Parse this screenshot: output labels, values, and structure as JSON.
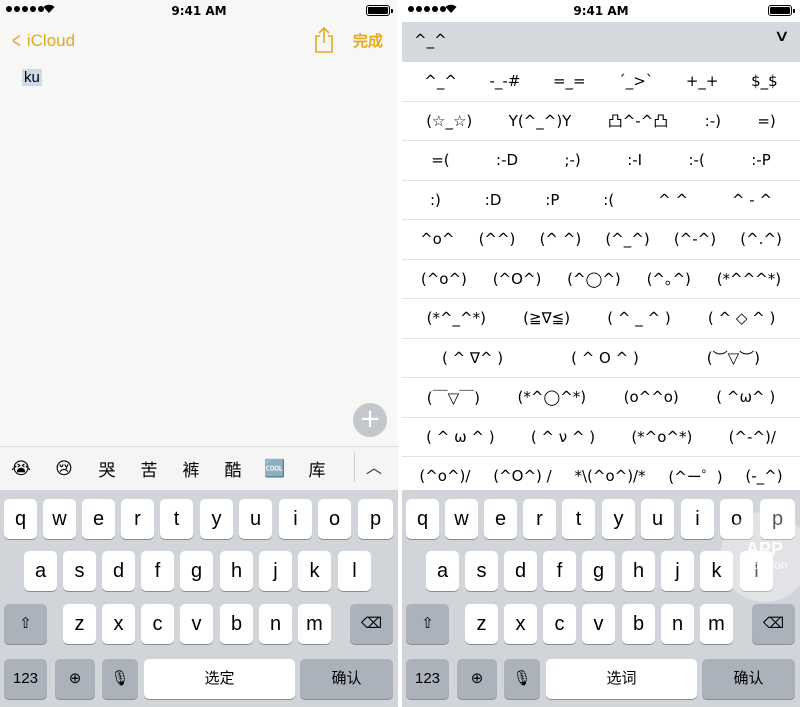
{
  "status_bar": {
    "time": "9:41 AM"
  },
  "notes": {
    "back_label": "iCloud",
    "done_label": "完成",
    "note_text": "ku"
  },
  "candidates": {
    "items": [
      {
        "text": "😭",
        "icon": "crying-face-icon"
      },
      {
        "text": "😢",
        "icon": "tear-face-icon"
      },
      {
        "text": "哭"
      },
      {
        "text": "苦"
      },
      {
        "text": "裤"
      },
      {
        "text": "酷"
      },
      {
        "text": "🆒",
        "icon": "cool-icon"
      },
      {
        "text": "库"
      }
    ]
  },
  "keyboard": {
    "row1": [
      "q",
      "w",
      "e",
      "r",
      "t",
      "y",
      "u",
      "i",
      "o",
      "p"
    ],
    "row2": [
      "a",
      "s",
      "d",
      "f",
      "g",
      "h",
      "j",
      "k",
      "l"
    ],
    "row3": [
      "z",
      "x",
      "c",
      "v",
      "b",
      "n",
      "m"
    ],
    "numbers_label": "123",
    "space_left": "选定",
    "space_right": "选词",
    "return_label": "确认"
  },
  "kaomoji": {
    "current": "^_^",
    "rows": [
      [
        "^_^",
        "-_-#",
        "=_=",
        "´_>`",
        "+_+",
        "$_$"
      ],
      [
        "(☆_☆)",
        "Y(^_^)Y",
        "凸^-^凸",
        ":-)",
        "=)"
      ],
      [
        "=(",
        ":-D",
        ";-)",
        ":-I",
        ":-(",
        ":-P"
      ],
      [
        ":)",
        ":D",
        ":P",
        ":(",
        "^ ^",
        "^ - ^"
      ],
      [
        "^o^",
        "(^^)",
        "(^ ^)",
        "(^_^)",
        "(^-^)",
        "(^.^)"
      ],
      [
        "(^o^)",
        "(^O^)",
        "(^◯^)",
        "(^｡^)",
        "(*^^^*)"
      ],
      [
        "(*^_^*)",
        "(≧∇≦)",
        "( ^ _ ^ )",
        "( ^ ◇ ^ )"
      ],
      [
        "( ^ ∇^ )",
        "( ^ O ^ )",
        "(︶▽︶)"
      ],
      [
        "(￣▽￣)",
        "(*^◯^*)",
        "(o^^o)",
        "( ^ω^ )"
      ],
      [
        "( ^ ω ^ )",
        "( ^ ν ^ )",
        "(*^o^*)",
        "(^-^)/"
      ],
      [
        "(^o^)/",
        "(^O^) /",
        "*\\(^o^)/*",
        "(^ー゜)",
        "(-_^)"
      ]
    ]
  },
  "watermark": {
    "line1": "APP",
    "line2": "solution"
  }
}
